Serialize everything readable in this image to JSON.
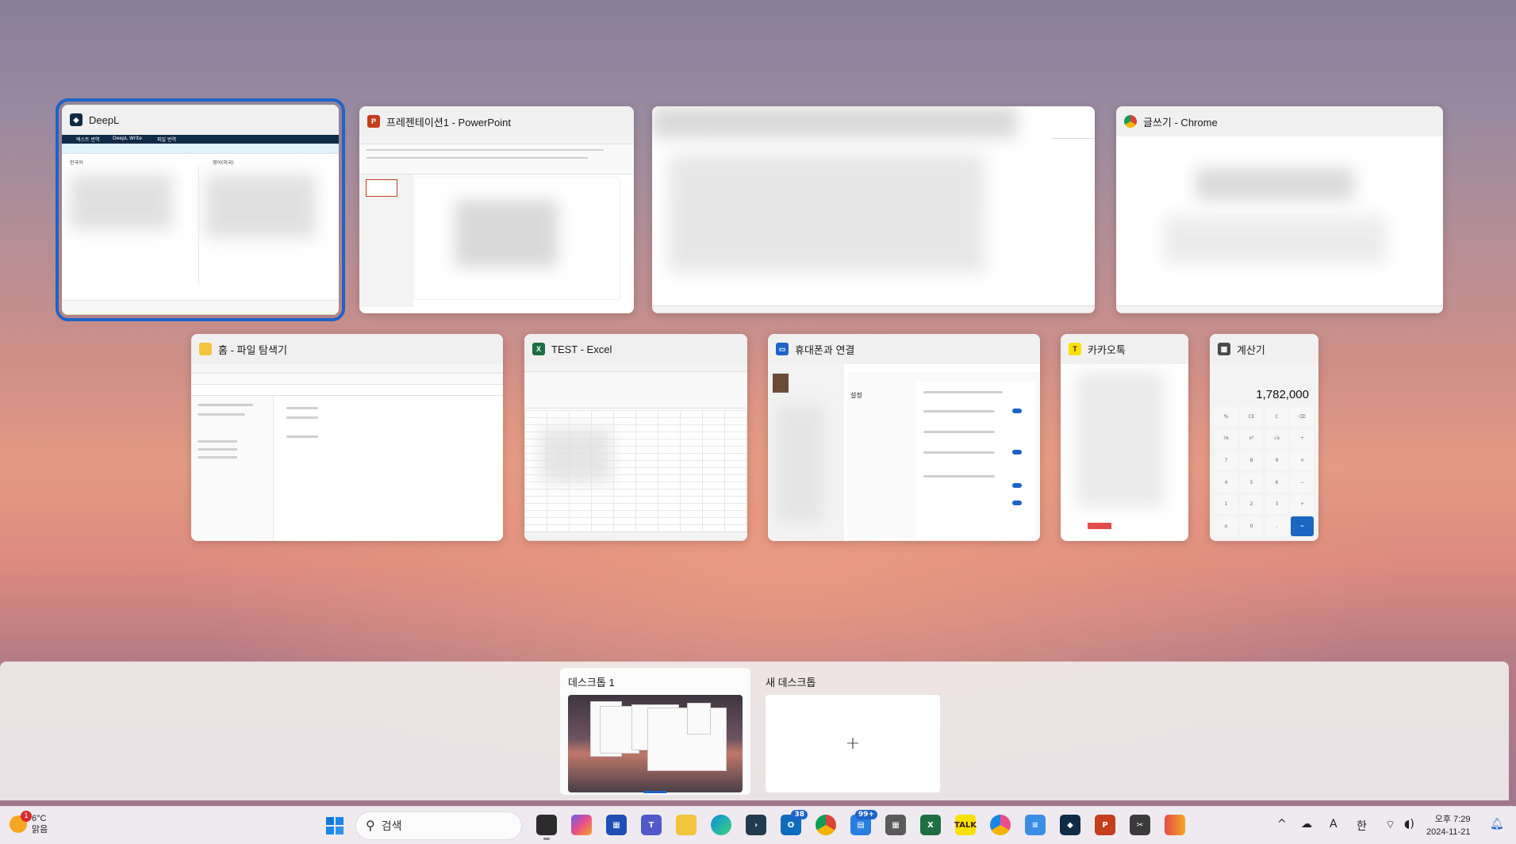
{
  "windows": {
    "deepl": {
      "title": "DeepL",
      "tab_text": "텍스트 번역",
      "tab_write": "DeepL Write",
      "tab_files": "파일 번역",
      "lang_source": "한국어",
      "lang_target": "영어(미국)"
    },
    "powerpoint": {
      "title": "프레젠테이션1 - PowerPoint"
    },
    "blurred": {
      "title": ""
    },
    "chrome": {
      "title": "글쓰기 - Chrome"
    },
    "explorer": {
      "title": "홈 - 파일 탐색기"
    },
    "excel": {
      "title": "TEST - Excel"
    },
    "phone": {
      "title": "휴대폰과 연결",
      "settings_heading": "설정"
    },
    "kakao": {
      "title": "카카오톡"
    },
    "calculator": {
      "title": "계산기",
      "display_value": "1,782,000"
    }
  },
  "desktops": {
    "current_label": "데스크톱 1",
    "new_label": "새 데스크톱",
    "new_plus": "+"
  },
  "taskbar": {
    "weather": {
      "temp": "6°C",
      "condition": "맑음",
      "badge": "1"
    },
    "search_placeholder": "검색",
    "badges": {
      "teams": "38",
      "planner": "99+"
    },
    "ime_mode": "A",
    "ime_lang": "한",
    "time": "오후 7:29",
    "date": "2024-11-21"
  },
  "colors": {
    "selection": "#1d63c8",
    "excel": "#1d6f42",
    "powerpoint": "#c43e1c",
    "kakao": "#fae100"
  }
}
